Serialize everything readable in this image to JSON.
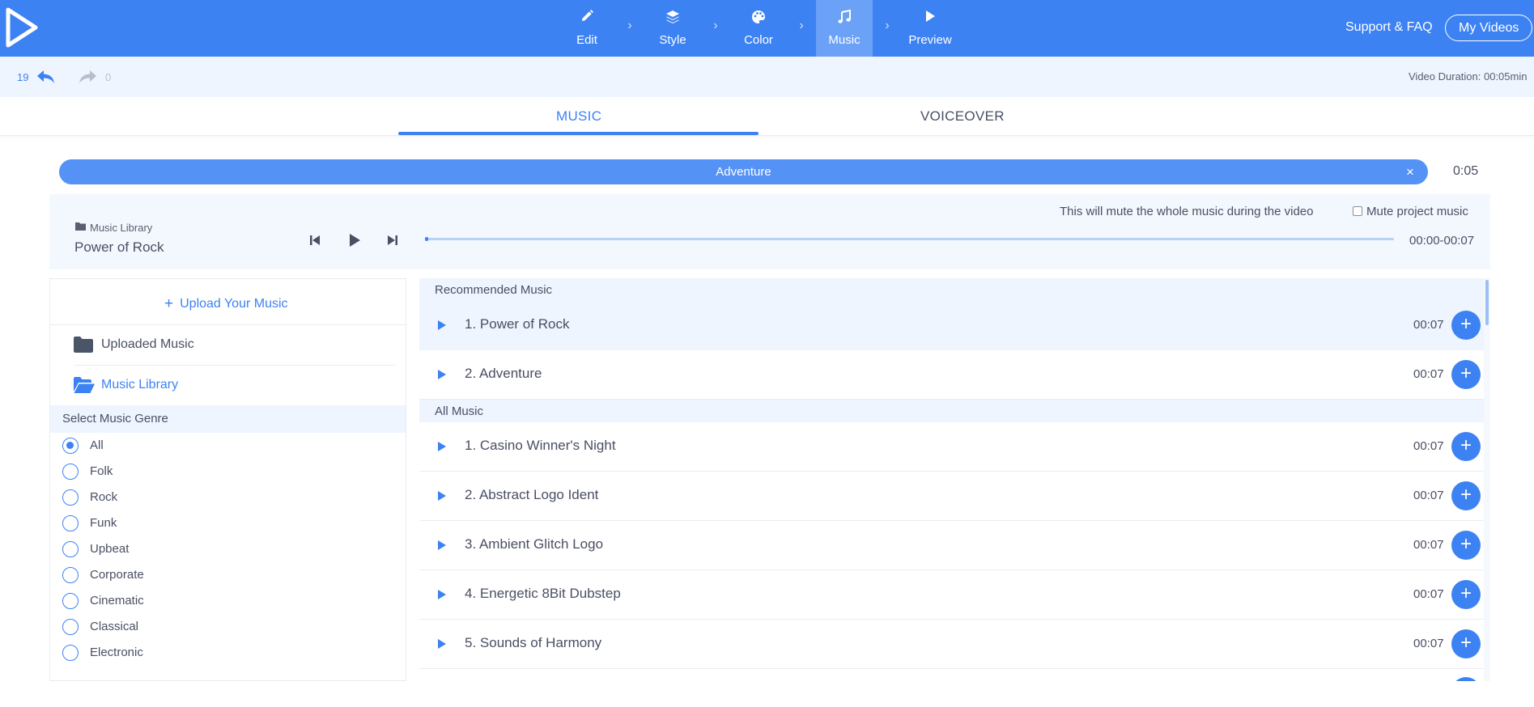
{
  "topbar": {
    "steps": [
      {
        "label": "Edit",
        "icon": "pencil-icon"
      },
      {
        "label": "Style",
        "icon": "layers-icon"
      },
      {
        "label": "Color",
        "icon": "palette-icon"
      },
      {
        "label": "Music",
        "icon": "music-note-icon"
      },
      {
        "label": "Preview",
        "icon": "play-icon"
      }
    ],
    "active_step": "Music",
    "support_label": "Support & FAQ",
    "my_videos_label": "My Videos"
  },
  "history": {
    "undo_count": "19",
    "redo_count": "0"
  },
  "video_duration": "Video Duration: 00:05min",
  "tabs": [
    {
      "label": "MUSIC"
    },
    {
      "label": "VOICEOVER"
    }
  ],
  "active_tab": "MUSIC",
  "track": {
    "name": "Adventure",
    "close": "×",
    "time": "0:05"
  },
  "player": {
    "source": "Music Library",
    "song": "Power of Rock",
    "time_range": "00:00-00:07",
    "progress": 0.0,
    "mute_note": "This will mute the whole music during the video",
    "mute_label": "Mute project music",
    "mute_checked": false
  },
  "sidebar": {
    "upload_label": "Upload Your Music",
    "uploaded_label": "Uploaded Music",
    "library_label": "Music Library",
    "genre_title": "Select Music Genre",
    "genres": [
      {
        "label": "All",
        "selected": true
      },
      {
        "label": "Folk",
        "selected": false
      },
      {
        "label": "Rock",
        "selected": false
      },
      {
        "label": "Funk",
        "selected": false
      },
      {
        "label": "Upbeat",
        "selected": false
      },
      {
        "label": "Corporate",
        "selected": false
      },
      {
        "label": "Cinematic",
        "selected": false
      },
      {
        "label": "Classical",
        "selected": false
      },
      {
        "label": "Electronic",
        "selected": false
      }
    ]
  },
  "recommended": {
    "title": "Recommended Music",
    "items": [
      {
        "name": "1. Power of Rock",
        "time": "00:07"
      },
      {
        "name": "2. Adventure",
        "time": "00:07"
      }
    ]
  },
  "all_music": {
    "title": "All Music",
    "items": [
      {
        "name": "1. Casino Winner's Night",
        "time": "00:07"
      },
      {
        "name": "2. Abstract Logo Ident",
        "time": "00:07"
      },
      {
        "name": "3. Ambient Glitch Logo",
        "time": "00:07"
      },
      {
        "name": "4. Energetic 8Bit Dubstep",
        "time": "00:07"
      },
      {
        "name": "5. Sounds of Harmony",
        "time": "00:07"
      }
    ]
  },
  "colors": {
    "accent": "#3d82f3",
    "track_bar": "#5592f5",
    "panel_bg": "#eef5ff"
  }
}
